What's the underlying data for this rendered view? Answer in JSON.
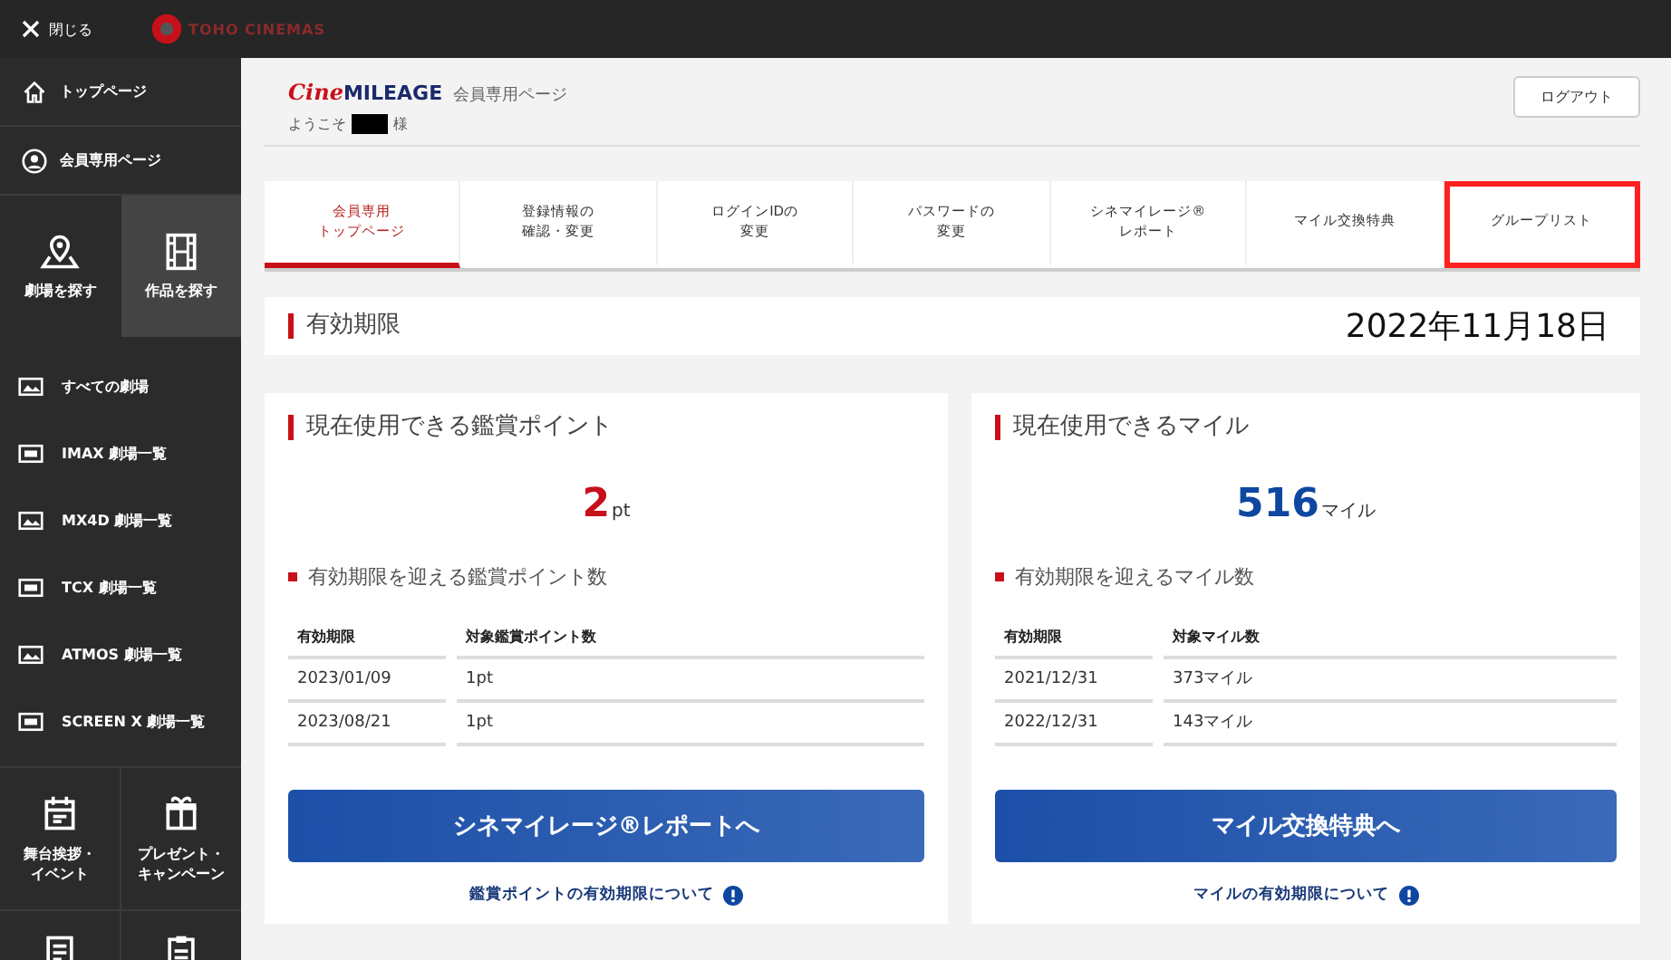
{
  "top_bar": {
    "close_label": "閉じる",
    "brand": "TOHO CINEMAS"
  },
  "sidebar": {
    "rows": [
      {
        "label": "トップページ"
      },
      {
        "label": "会員専用ページ"
      }
    ],
    "tiles": [
      {
        "label": "劇場を探す",
        "selected": false
      },
      {
        "label": "作品を探す",
        "selected": true
      }
    ],
    "theater_lists": [
      {
        "label": "すべての劇場"
      },
      {
        "label": "IMAX 劇場一覧"
      },
      {
        "label": "MX4D 劇場一覧"
      },
      {
        "label": "TCX 劇場一覧"
      },
      {
        "label": "ATMOS 劇場一覧"
      },
      {
        "label": "SCREEN X 劇場一覧"
      }
    ],
    "bottom_tiles": [
      {
        "label_lines": [
          "舞台挨拶・",
          "イベント"
        ]
      },
      {
        "label_lines": [
          "プレゼント・",
          "キャンペーン"
        ]
      }
    ]
  },
  "header": {
    "logo_script": "Cine",
    "logo_word": "MILEAGE",
    "page_label": "会員専用ページ",
    "welcome_prefix": "ようこそ",
    "welcome_suffix": "様",
    "logout_button": "ログアウト"
  },
  "tabs": [
    {
      "label_lines": [
        "会員専用",
        "トップページ"
      ],
      "selected": true,
      "highlighted": false
    },
    {
      "label_lines": [
        "登録情報の",
        "確認・変更"
      ],
      "selected": false,
      "highlighted": false
    },
    {
      "label_lines": [
        "ログインIDの",
        "変更"
      ],
      "selected": false,
      "highlighted": false
    },
    {
      "label_lines": [
        "パスワードの",
        "変更"
      ],
      "selected": false,
      "highlighted": false
    },
    {
      "label_lines": [
        "シネマイレージ®",
        "レポート"
      ],
      "selected": false,
      "highlighted": false
    },
    {
      "label_lines": [
        "マイル交換特典"
      ],
      "selected": false,
      "highlighted": false
    },
    {
      "label_lines": [
        "グループリスト"
      ],
      "selected": false,
      "highlighted": true
    }
  ],
  "expiry": {
    "title": "有効期限",
    "date": "2022年11月18日"
  },
  "cards": [
    {
      "title": "現在使用できる鑑賞ポイント",
      "amount": "2",
      "unit": "pt",
      "color": "#c8101a",
      "subheading": "有効期限を迎える鑑賞ポイント数",
      "columns": [
        "有効期限",
        "対象鑑賞ポイント数"
      ],
      "rows": [
        [
          "2023/01/09",
          "1pt"
        ],
        [
          "2023/08/21",
          "1pt"
        ]
      ],
      "button": "シネマイレージ®レポートへ",
      "note": "鑑賞ポイントの有効期限について"
    },
    {
      "title": "現在使用できるマイル",
      "amount": "516",
      "unit": "マイル",
      "color": "#0d47a1",
      "subheading": "有効期限を迎えるマイル数",
      "columns": [
        "有効期限",
        "対象マイル数"
      ],
      "rows": [
        [
          "2021/12/31",
          "373マイル"
        ],
        [
          "2022/12/31",
          "143マイル"
        ]
      ],
      "button": "マイル交換特典へ",
      "note": "マイルの有効期限について"
    }
  ]
}
